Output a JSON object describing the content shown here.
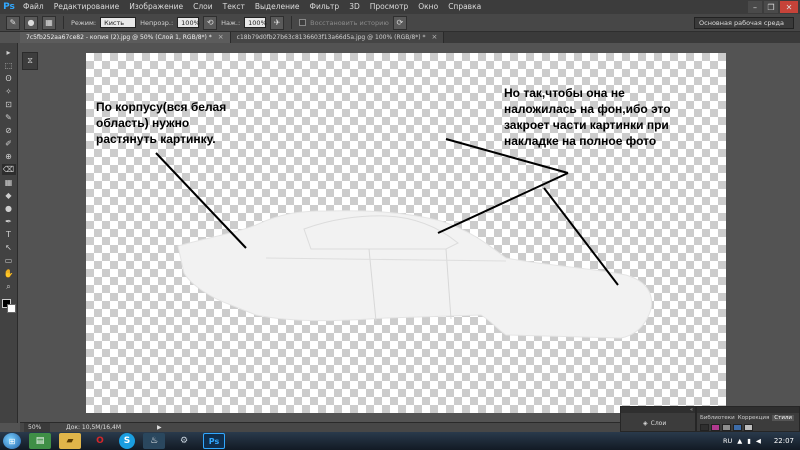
{
  "app": {
    "logo": "Ps"
  },
  "menu": {
    "items": [
      "Файл",
      "Редактирование",
      "Изображение",
      "Слои",
      "Текст",
      "Выделение",
      "Фильтр",
      "3D",
      "Просмотр",
      "Окно",
      "Справка"
    ]
  },
  "window_controls": {
    "minimize": "–",
    "restore": "❐",
    "close": "✕"
  },
  "options": {
    "mode_label": "Режим:",
    "mode_value": "Кисть",
    "opacity_label": "Непрозр.:",
    "opacity_value": "100%",
    "flow_label": "Наж.:",
    "flow_value": "100%",
    "history_label": "Восстановить историю",
    "workspace": "Основная рабочая среда"
  },
  "tabs": [
    {
      "label": "7c5fb252aa67ce82 - копия (2).jpg @ 50% (Слой 1, RGB/8*) *",
      "close": "×"
    },
    {
      "label": "c18b79d0fb27b63c8136603f13a66d5a.jpg @ 100% (RGB/8*) *",
      "close": "×"
    }
  ],
  "tools": [
    "▸",
    "⬚",
    "ʘ",
    "✧",
    "⊡",
    "✎",
    "⊘",
    "✐",
    "⊕",
    "⌫",
    "▦",
    "◆",
    "●",
    "✒",
    "T",
    "↖",
    "▭",
    "✋",
    "⌕"
  ],
  "annotations": {
    "left": [
      "По корпусу(вся белая",
      "область) нужно",
      "растянуть картинку."
    ],
    "right": [
      "Но так,чтобы она не",
      "наложилась на фон,ибо это",
      "закроет части картинки при",
      "накладке на полное фото"
    ]
  },
  "status": {
    "zoom": "50%",
    "doc_size": "Док: 10,5M/16,4M",
    "arrow": "▶"
  },
  "panels": {
    "layers_label": "Слои",
    "tabs": [
      "Библиотеки",
      "Коррекция",
      "Стили"
    ],
    "active_tab": "Стили"
  },
  "colors": {
    "foreground": "#000000",
    "background": "#ffffff",
    "ps_blue": "#31a8ff",
    "swatches": [
      "#2f2f2f",
      "#b23a8f",
      "#8d8d8d",
      "#3d6ca8",
      "#bdbdbd"
    ]
  },
  "taskbar": {
    "apps": [
      {
        "name": "excel-app",
        "glyph": "▤",
        "color": "#3f8f46"
      },
      {
        "name": "explorer-app",
        "glyph": "▰",
        "color": "#e0b54a"
      },
      {
        "name": "opera-app",
        "glyph": "O",
        "color": "#d6262a"
      },
      {
        "name": "skype-app",
        "glyph": "S",
        "color": "#1a9ee0"
      },
      {
        "name": "steam-app",
        "glyph": "♨",
        "color": "#2a475e"
      },
      {
        "name": "settings-app",
        "glyph": "⚙",
        "color": "#6d7f92"
      },
      {
        "name": "photoshop-app",
        "glyph": "Ps",
        "color": "#0f2e4d"
      }
    ],
    "lang": "RU",
    "clock": "22:07"
  }
}
